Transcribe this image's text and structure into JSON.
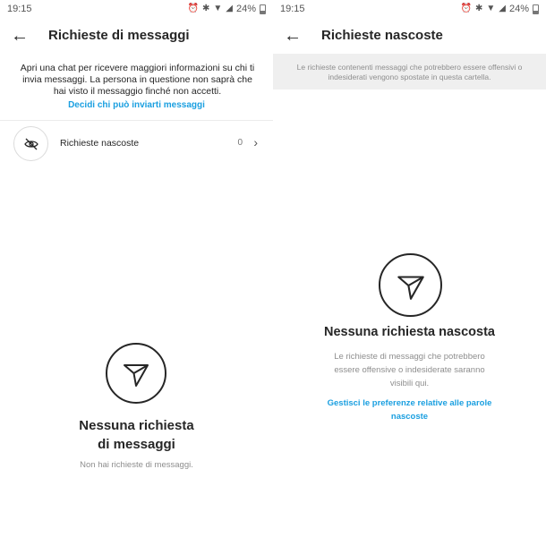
{
  "left": {
    "status_time": "19:15",
    "battery": "24%",
    "title": "Richieste di messaggi",
    "info_text": "Apri una chat per ricevere maggiori informazioni su chi ti invia messaggi. La persona in questione non saprà che hai visto il messaggio finché non accetti.",
    "info_link": "Decidi chi può inviarti messaggi",
    "hidden_requests_label": "Richieste nascoste",
    "hidden_requests_count": "0",
    "empty_title_line1": "Nessuna richiesta",
    "empty_title_line2": "di messaggi",
    "empty_subtitle": "Non hai richieste di messaggi."
  },
  "right": {
    "status_time": "19:15",
    "battery": "24%",
    "title": "Richieste nascoste",
    "banner_text": "Le richieste contenenti messaggi che potrebbero essere offensivi o indesiderati vengono spostate in questa cartella.",
    "empty_title": "Nessuna richiesta nascosta",
    "empty_subtitle": "Le richieste di messaggi che potrebbero essere offensive o indesiderate saranno visibili qui.",
    "empty_link": "Gestisci le preferenze relative alle parole nascoste"
  },
  "icons": {
    "back": "arrow-left-icon",
    "hidden": "eye-off-icon",
    "chevron": "chevron-right-icon",
    "empty": "paper-plane-icon",
    "alarm": "alarm-icon",
    "bluetooth": "bluetooth-icon",
    "wifi": "wifi-icon",
    "signal": "signal-icon",
    "battery": "battery-icon"
  },
  "colors": {
    "link": "#1a9fe0",
    "text": "#262626",
    "muted": "#8e8e8e",
    "banner_bg": "#efefef"
  }
}
